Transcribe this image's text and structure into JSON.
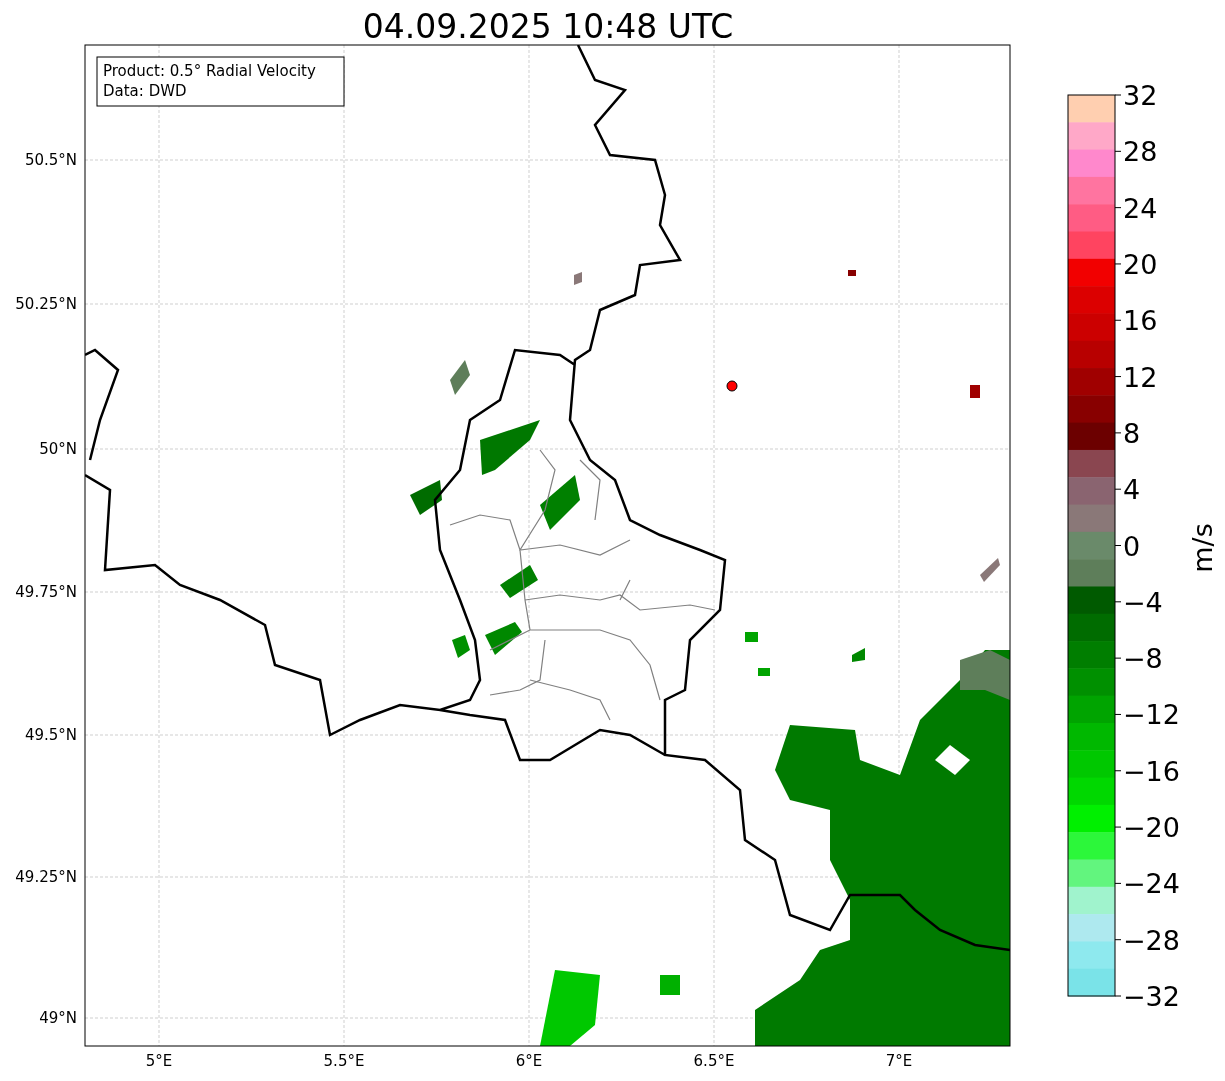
{
  "title": "04.09.2025 10:48 UTC",
  "info_box": [
    "Product: 0.5° Radial Velocity",
    "Data: DWD"
  ],
  "y_ticks": [
    "50.5°N",
    "50.25°N",
    "50°N",
    "49.75°N",
    "49.5°N",
    "49.25°N",
    "49°N"
  ],
  "x_ticks": [
    "5°E",
    "5.5°E",
    "6°E",
    "6.5°E",
    "7°E"
  ],
  "colorbar": {
    "label": "m/s",
    "ticks": [
      "32",
      "28",
      "24",
      "20",
      "16",
      "12",
      "8",
      "4",
      "0",
      "−4",
      "−8",
      "−12",
      "−16",
      "−20",
      "−24",
      "−28",
      "−32"
    ],
    "bands": [
      {
        "color": "#ffcfb0"
      },
      {
        "color": "#ffa8c8"
      },
      {
        "color": "#ff88cc"
      },
      {
        "color": "#ff74a0"
      },
      {
        "color": "#ff5c84"
      },
      {
        "color": "#ff4460"
      },
      {
        "color": "#f20000"
      },
      {
        "color": "#dc0000"
      },
      {
        "color": "#cc0000"
      },
      {
        "color": "#b80000"
      },
      {
        "color": "#a00000"
      },
      {
        "color": "#880000"
      },
      {
        "color": "#6c0000"
      },
      {
        "color": "#8a4650"
      },
      {
        "color": "#8a6470"
      },
      {
        "color": "#8a7878"
      },
      {
        "color": "#6a8a6a"
      },
      {
        "color": "#5e7e5a"
      },
      {
        "color": "#005a00"
      },
      {
        "color": "#006c00"
      },
      {
        "color": "#007e00"
      },
      {
        "color": "#009000"
      },
      {
        "color": "#00a400"
      },
      {
        "color": "#00b800"
      },
      {
        "color": "#00c800"
      },
      {
        "color": "#00d800"
      },
      {
        "color": "#00f000"
      },
      {
        "color": "#2cf73a"
      },
      {
        "color": "#62f57e"
      },
      {
        "color": "#a0f3cd"
      },
      {
        "color": "#aee9ef"
      },
      {
        "color": "#8ee9ee"
      },
      {
        "color": "#7ae3e8"
      }
    ]
  }
}
